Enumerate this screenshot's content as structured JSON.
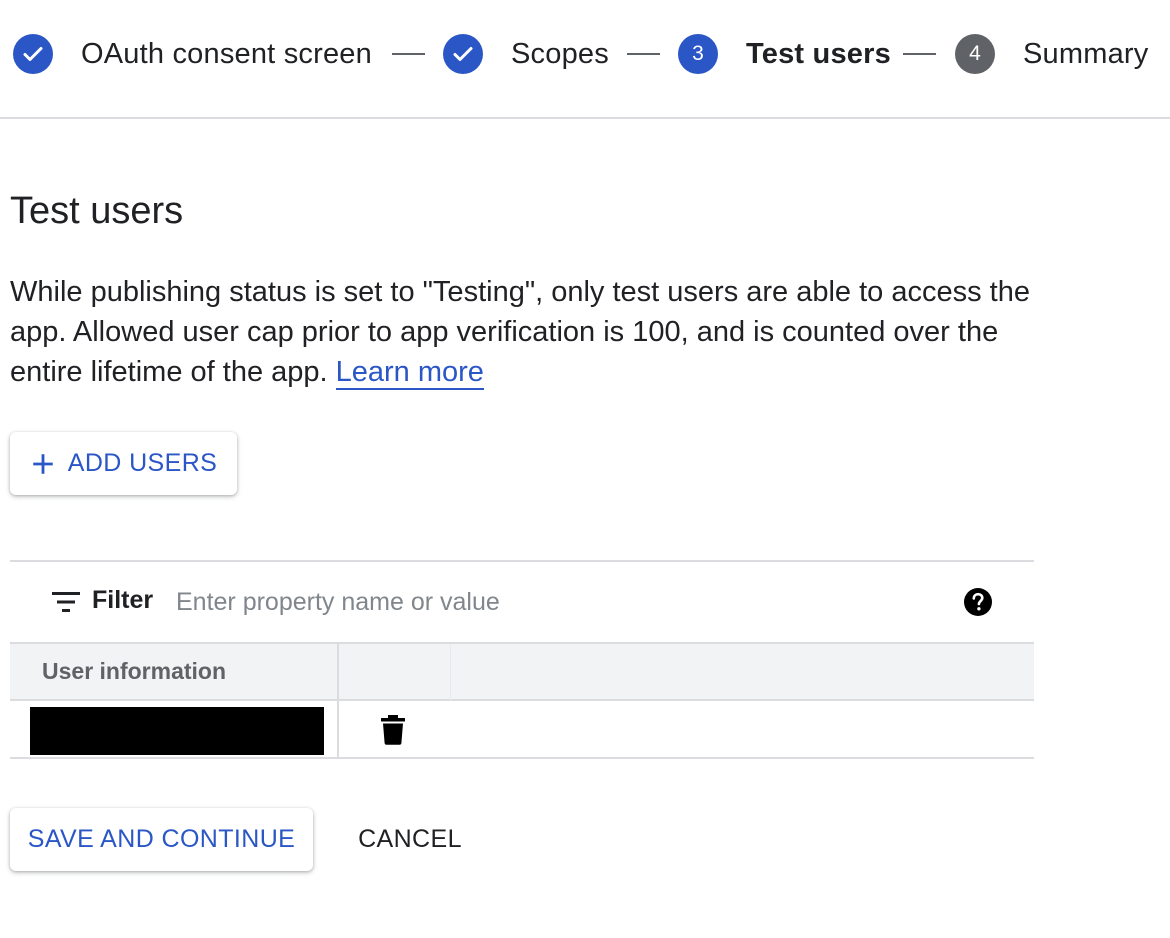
{
  "stepper": {
    "steps": [
      {
        "label": "OAuth consent screen",
        "state": "done"
      },
      {
        "label": "Scopes",
        "state": "done"
      },
      {
        "label": "Test users",
        "state": "active",
        "number": "3"
      },
      {
        "label": "Summary",
        "state": "todo",
        "number": "4"
      }
    ]
  },
  "page": {
    "title": "Test users",
    "description": "While publishing status is set to \"Testing\", only test users are able to access the app. Allowed user cap prior to app verification is 100, and is counted over the entire lifetime of the app.",
    "learn_more": "Learn more"
  },
  "add_users_label": "ADD USERS",
  "filter": {
    "label": "Filter",
    "placeholder": "Enter property name or value"
  },
  "table": {
    "columns": [
      "User information"
    ],
    "rows": [
      {
        "user": ""
      }
    ]
  },
  "actions": {
    "save_label": "SAVE AND CONTINUE",
    "cancel_label": "CANCEL"
  },
  "colors": {
    "accent": "#2a56c6",
    "pending_step": "#5f6368",
    "divider": "#dadce0"
  },
  "icons": {
    "done_step": "check-icon",
    "filter": "filter-icon",
    "help": "help-icon",
    "delete": "trash-icon",
    "add": "plus-icon"
  }
}
